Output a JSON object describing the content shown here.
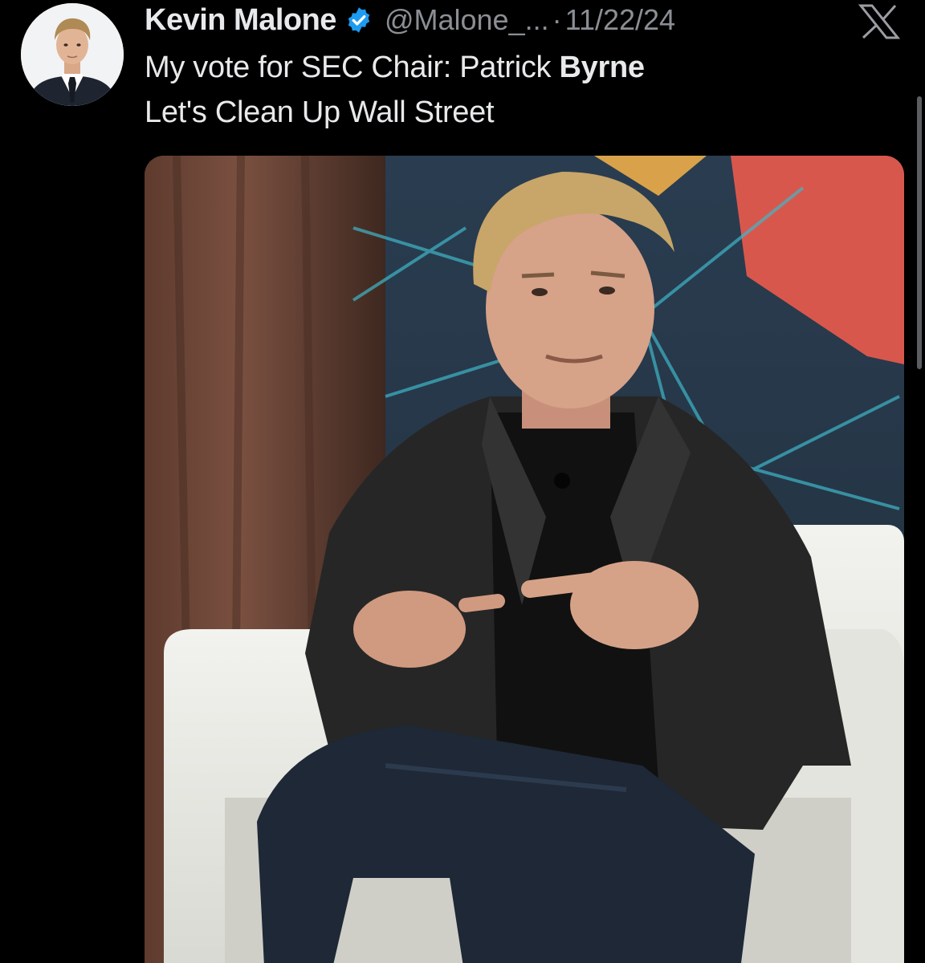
{
  "author": {
    "display_name": "Kevin Malone",
    "handle": "@Malone_...",
    "separator": "·",
    "date": "11/22/24",
    "verified_icon": "verified-badge-icon"
  },
  "brand": {
    "logo_icon": "x-logo-icon"
  },
  "tweet": {
    "line1_prefix": "My vote for SEC Chair: Patrick ",
    "line1_bold": "Byrne",
    "line2": "Let's Clean Up Wall Street"
  },
  "colors": {
    "background": "#000000",
    "text_primary": "#e7e9ea",
    "text_secondary": "#8b8f94",
    "verified": "#1d9bf0"
  }
}
